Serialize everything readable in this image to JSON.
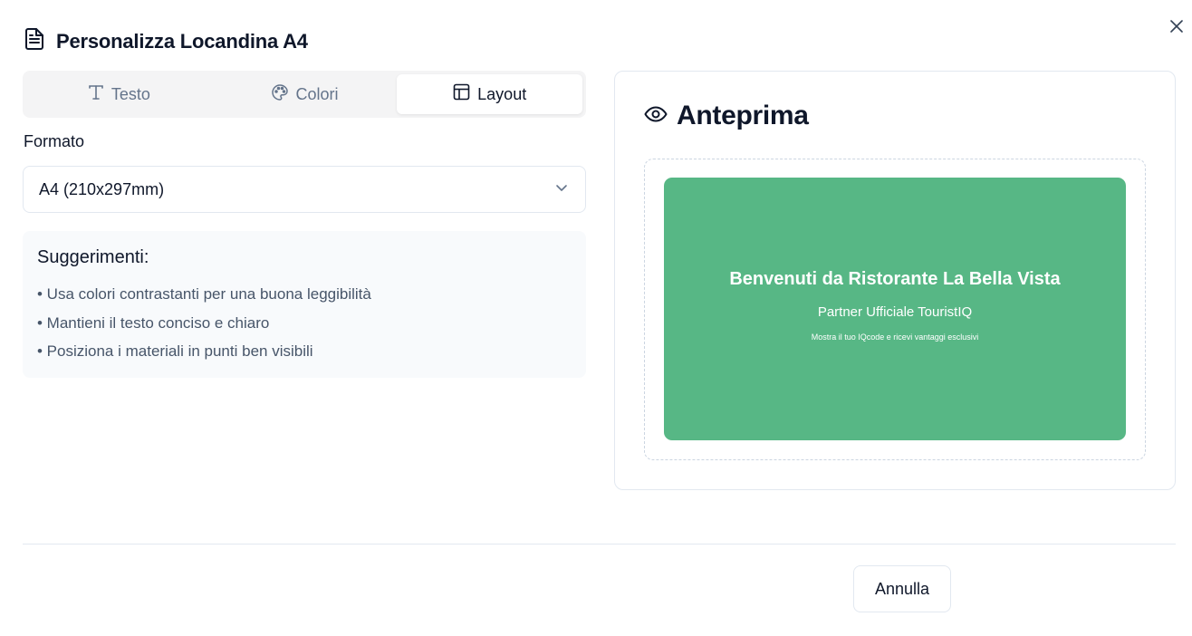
{
  "dialog": {
    "title": "Personalizza Locandina A4",
    "title_icon": "file-text-icon",
    "close_icon": "close-icon"
  },
  "tabs": [
    {
      "label": "Testo",
      "icon": "type-icon",
      "active": false
    },
    {
      "label": "Colori",
      "icon": "palette-icon",
      "active": false
    },
    {
      "label": "Layout",
      "icon": "layout-icon",
      "active": true
    }
  ],
  "format": {
    "label": "Formato",
    "selected": "A4 (210x297mm)"
  },
  "tips": {
    "title": "Suggerimenti:",
    "items": [
      "• Usa colori contrastanti per una buona leggibilità",
      "• Mantieni il testo conciso e chiaro",
      "• Posiziona i materiali in punti ben visibili"
    ]
  },
  "preview": {
    "title": "Anteprima",
    "icon": "eye-icon",
    "poster": {
      "title": "Benvenuti da Ristorante La Bella Vista",
      "subtitle": "Partner Ufficiale TouristIQ",
      "note": "Mostra il tuo IQcode e ricevi vantaggi esclusivi",
      "background_color": "#57b785",
      "text_color": "#ffffff"
    }
  },
  "footer": {
    "cancel_label": "Annulla"
  }
}
